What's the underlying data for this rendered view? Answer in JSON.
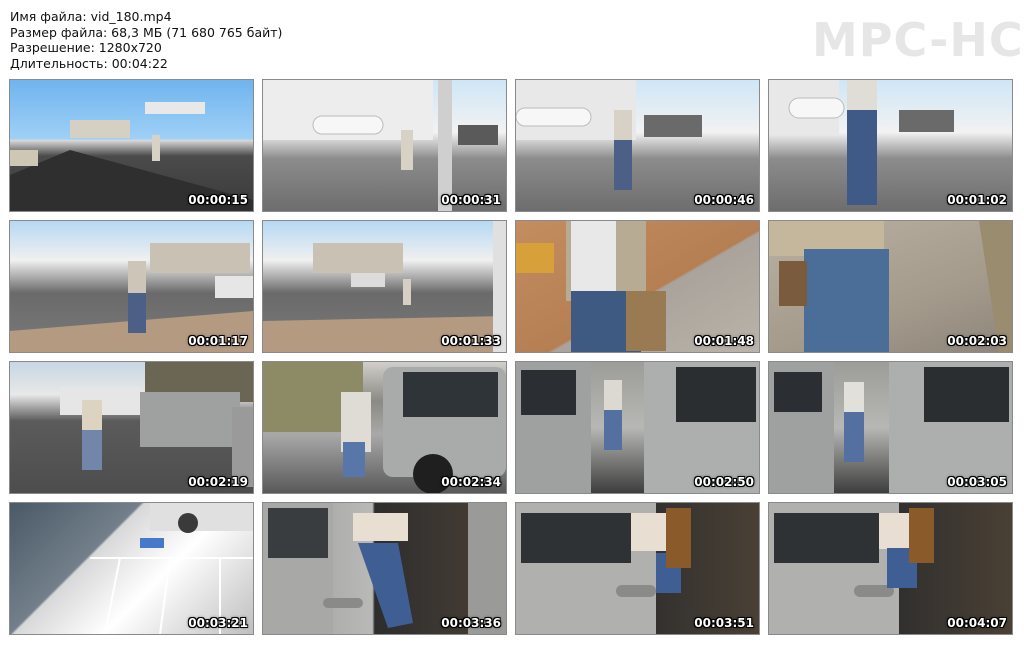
{
  "header": {
    "file_name": "Имя файла: vid_180.mp4",
    "file_size": "Размер файла: 68,3 МБ (71 680 765 байт)",
    "resolution": "Разрешение: 1280x720",
    "duration": "Длительность: 00:04:22"
  },
  "logo": "MPC-HC",
  "thumbnails": [
    {
      "time": "00:00:15"
    },
    {
      "time": "00:00:31"
    },
    {
      "time": "00:00:46"
    },
    {
      "time": "00:01:02"
    },
    {
      "time": "00:01:17"
    },
    {
      "time": "00:01:33"
    },
    {
      "time": "00:01:48"
    },
    {
      "time": "00:02:03"
    },
    {
      "time": "00:02:19"
    },
    {
      "time": "00:02:34"
    },
    {
      "time": "00:02:50"
    },
    {
      "time": "00:03:05"
    },
    {
      "time": "00:03:21"
    },
    {
      "time": "00:03:36"
    },
    {
      "time": "00:03:51"
    },
    {
      "time": "00:04:07"
    }
  ]
}
